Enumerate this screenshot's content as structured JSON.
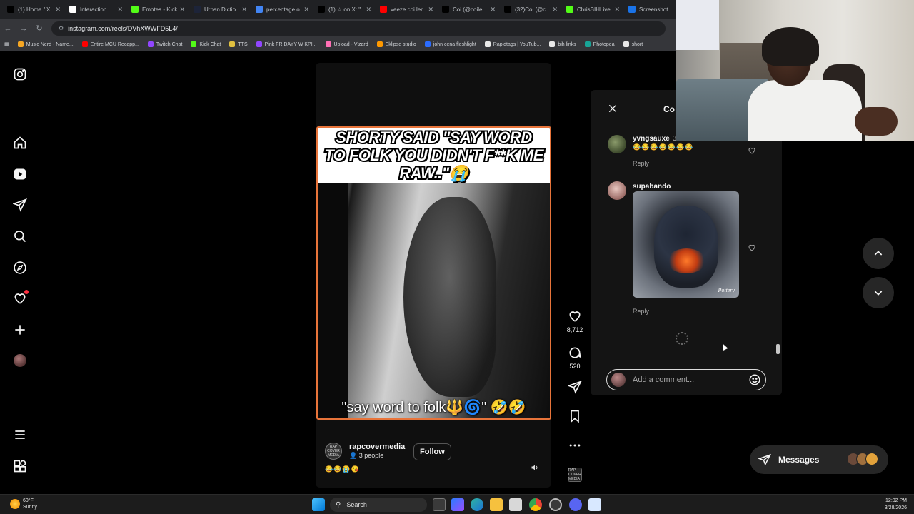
{
  "browser": {
    "tabs": [
      {
        "label": "(1) Home / X",
        "icon_color": "#000000",
        "icon": "x-logo-icon"
      },
      {
        "label": "Interaction |",
        "icon_color": "#ffffff",
        "icon": "interaction-icon"
      },
      {
        "label": "Emotes - Kick",
        "icon_color": "#53fc18",
        "icon": "kick-icon"
      },
      {
        "label": "Urban Dictio",
        "icon_color": "#1d2439",
        "icon": "urban-dictionary-icon"
      },
      {
        "label": "percentage o",
        "icon_color": "#4285f4",
        "icon": "google-icon"
      },
      {
        "label": "(1) ☆ on X: \"",
        "icon_color": "#000000",
        "icon": "x-logo-icon"
      },
      {
        "label": "veeze coi ler",
        "icon_color": "#ff0000",
        "icon": "youtube-icon"
      },
      {
        "label": "Coi (@coile",
        "icon_color": "#000000",
        "icon": "tiktok-icon"
      },
      {
        "label": "(32)Coi (@c",
        "icon_color": "#000000",
        "icon": "tiktok-icon"
      },
      {
        "label": "ChrisBIHLive",
        "icon_color": "#53fc18",
        "icon": "kick-icon"
      },
      {
        "label": "Screenshot",
        "icon_color": "#1a73e8",
        "icon": "screenshot-icon"
      }
    ],
    "url": "instagram.com/reels/DVhXWWFD5L4/",
    "bookmarks": [
      {
        "label": "Music Nerd - Name...",
        "color": "#f5a623"
      },
      {
        "label": "Entire MCU Recapp...",
        "color": "#ff0000"
      },
      {
        "label": "Twitch Chat",
        "color": "#9146ff"
      },
      {
        "label": "Kick Chat",
        "color": "#53fc18"
      },
      {
        "label": "TTS",
        "color": "#e0c040"
      },
      {
        "label": "Pink FRIDAYY W KPI...",
        "color": "#9146ff"
      },
      {
        "label": "Upload - Vizard",
        "color": "#ff6fb5"
      },
      {
        "label": "Eklipse studio",
        "color": "#ff9900"
      },
      {
        "label": "john cena fleshlight",
        "color": "#2b6cff"
      },
      {
        "label": "Rapidtags | YouTub...",
        "color": "#e8e8e8"
      },
      {
        "label": "bih links",
        "color": "#e8e8e8"
      },
      {
        "label": "Photopea",
        "color": "#18a497"
      },
      {
        "label": "short",
        "color": "#e8e8e8"
      }
    ]
  },
  "reel": {
    "caption": "SHORTY SAID \"SAY WORD TO FOLK YOU DIDN'T F**K ME RAW..\"😭",
    "subtitle": "\"say word to folk🔱🌀\" 🤣🤣",
    "likes": "8,712",
    "comments": "520",
    "author": "rapcovermedia",
    "author_badge": "RAP COVER MEDIA",
    "audience": "3 people",
    "follow_label": "Follow",
    "emoji_line": "😂😂😭😘",
    "accent_color": "#e8743a"
  },
  "comments_panel": {
    "title": "Co",
    "comments": [
      {
        "user": "yvngsauxe",
        "time": "3w",
        "text": "😂😂😂😂😂😂😂",
        "reply": "Reply"
      },
      {
        "user": "supabando",
        "reply": "Reply",
        "gif_watermark": "Pottery"
      }
    ],
    "input_placeholder": "Add a comment..."
  },
  "messages": {
    "label": "Messages"
  },
  "taskbar": {
    "temperature": "60°F",
    "weather": "Sunny",
    "search": "Search",
    "time": "12:02 PM",
    "date": "3/28/2026"
  }
}
